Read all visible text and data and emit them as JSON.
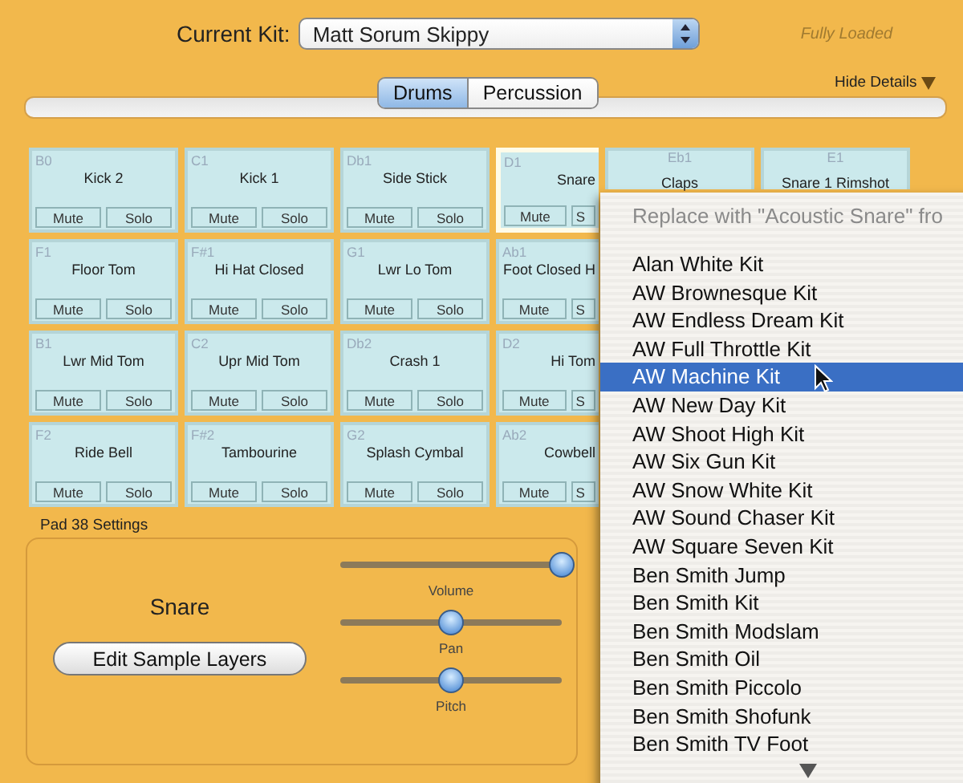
{
  "header": {
    "label": "Current Kit:",
    "kit": "Matt Sorum Skippy",
    "status": "Fully Loaded"
  },
  "tabs": [
    {
      "label": "Drums",
      "selected": true
    },
    {
      "label": "Percussion",
      "selected": false
    }
  ],
  "details_toggle": "Hide Details",
  "pad_rows": [
    [
      {
        "kind": "full",
        "note": "B0",
        "name": "Kick 2",
        "mute": "Mute",
        "solo": "Solo",
        "selected": false
      },
      {
        "kind": "full",
        "note": "C1",
        "name": "Kick 1",
        "mute": "Mute",
        "solo": "Solo",
        "selected": false
      },
      {
        "kind": "full",
        "note": "Db1",
        "name": "Side Stick",
        "mute": "Mute",
        "solo": "Solo",
        "selected": false
      },
      {
        "kind": "cut",
        "note": "D1",
        "name": "Snare",
        "mute": "Mute",
        "solo": "S",
        "selected": true
      },
      {
        "kind": "top",
        "note": "Eb1",
        "name": "Claps",
        "selected": false
      },
      {
        "kind": "top",
        "note": "E1",
        "name": "Snare 1 Rimshot",
        "selected": false
      }
    ],
    [
      {
        "kind": "full",
        "note": "F1",
        "name": "Floor Tom",
        "mute": "Mute",
        "solo": "Solo",
        "selected": false
      },
      {
        "kind": "full",
        "note": "F#1",
        "name": "Hi Hat Closed",
        "mute": "Mute",
        "solo": "Solo",
        "selected": false
      },
      {
        "kind": "full",
        "note": "G1",
        "name": "Lwr Lo Tom",
        "mute": "Mute",
        "solo": "Solo",
        "selected": false
      },
      {
        "kind": "cut",
        "note": "Ab1",
        "name": "Foot Closed H",
        "mute": "Mute",
        "solo": "S",
        "selected": false
      }
    ],
    [
      {
        "kind": "full",
        "note": "B1",
        "name": "Lwr Mid Tom",
        "mute": "Mute",
        "solo": "Solo",
        "selected": false
      },
      {
        "kind": "full",
        "note": "C2",
        "name": "Upr Mid Tom",
        "mute": "Mute",
        "solo": "Solo",
        "selected": false
      },
      {
        "kind": "full",
        "note": "Db2",
        "name": "Crash 1",
        "mute": "Mute",
        "solo": "Solo",
        "selected": false
      },
      {
        "kind": "cut",
        "note": "D2",
        "name": "Hi Tom",
        "mute": "Mute",
        "solo": "S",
        "selected": false
      }
    ],
    [
      {
        "kind": "full",
        "note": "F2",
        "name": "Ride Bell",
        "mute": "Mute",
        "solo": "Solo",
        "selected": false
      },
      {
        "kind": "full",
        "note": "F#2",
        "name": "Tambourine",
        "mute": "Mute",
        "solo": "Solo",
        "selected": false
      },
      {
        "kind": "full",
        "note": "G2",
        "name": "Splash Cymbal",
        "mute": "Mute",
        "solo": "Solo",
        "selected": false
      },
      {
        "kind": "cut",
        "note": "Ab2",
        "name": "Cowbell",
        "mute": "Mute",
        "solo": "S",
        "selected": false
      }
    ]
  ],
  "settings": {
    "title": "Pad 38 Settings",
    "pad_name": "Snare",
    "button": "Edit Sample Layers",
    "sliders": [
      {
        "label": "Volume",
        "level": 1
      },
      {
        "label": "Pan",
        "level": 0.5
      },
      {
        "label": "Pitch",
        "level": 0.5
      }
    ]
  },
  "menu": {
    "header": "Replace with \"Acoustic Snare\" fro",
    "items": [
      {
        "label": "Alan White Kit",
        "selected": false
      },
      {
        "label": "AW Brownesque Kit",
        "selected": false
      },
      {
        "label": "AW Endless Dream Kit",
        "selected": false
      },
      {
        "label": "AW Full Throttle Kit",
        "selected": false
      },
      {
        "label": "AW Machine Kit",
        "selected": true
      },
      {
        "label": "AW New Day Kit",
        "selected": false
      },
      {
        "label": "AW Shoot High Kit",
        "selected": false
      },
      {
        "label": "AW Six Gun Kit",
        "selected": false
      },
      {
        "label": "AW Snow White Kit",
        "selected": false
      },
      {
        "label": "AW Sound Chaser Kit",
        "selected": false
      },
      {
        "label": "AW Square Seven Kit",
        "selected": false
      },
      {
        "label": "Ben Smith Jump",
        "selected": false
      },
      {
        "label": "Ben Smith Kit",
        "selected": false
      },
      {
        "label": "Ben Smith Modslam",
        "selected": false
      },
      {
        "label": "Ben Smith Oil",
        "selected": false
      },
      {
        "label": "Ben Smith Piccolo",
        "selected": false
      },
      {
        "label": "Ben Smith Shofunk",
        "selected": false
      },
      {
        "label": "Ben Smith TV Foot",
        "selected": false
      }
    ]
  }
}
